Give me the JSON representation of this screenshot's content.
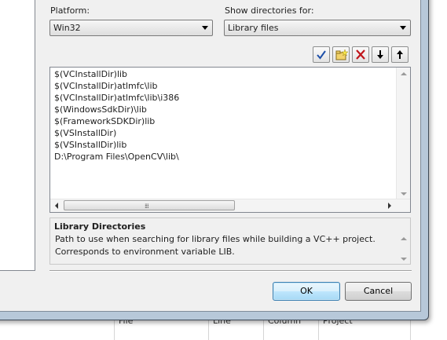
{
  "background": {
    "columns": [
      "File",
      "Line",
      "Column",
      "Project"
    ]
  },
  "platform": {
    "label": "Platform:",
    "value": "Win32"
  },
  "show_dirs": {
    "label": "Show directories for:",
    "value": "Library files"
  },
  "toolbar": {
    "buttons": [
      "check-icon",
      "new-folder-icon",
      "delete-icon",
      "move-down-icon",
      "move-up-icon"
    ]
  },
  "directories": [
    "$(VCInstallDir)lib",
    "$(VCInstallDir)atlmfc\\lib",
    "$(VCInstallDir)atlmfc\\lib\\i386",
    "$(WindowsSdkDir)\\lib",
    "$(FrameworkSDKDir)lib",
    "$(VSInstallDir)",
    "$(VSInstallDir)lib",
    "D:\\Program Files\\OpenCV\\lib\\"
  ],
  "description": {
    "title": "Library Directories",
    "line1": "Path to use when searching for library files while building a VC++ project.",
    "line2": "Corresponds to environment variable LIB."
  },
  "buttons": {
    "ok": "OK",
    "cancel": "Cancel"
  },
  "colors": {
    "accent": "#3c7fb1",
    "delete": "#c0161c",
    "check": "#1d4fa8"
  }
}
